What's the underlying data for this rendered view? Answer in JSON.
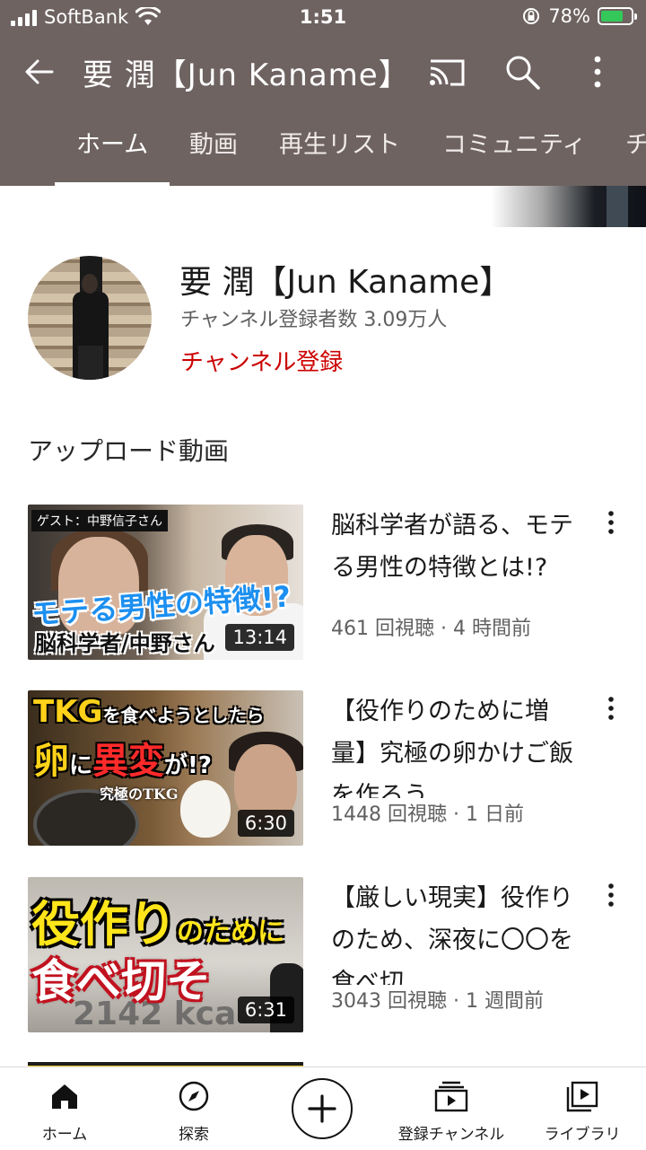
{
  "status_bar": {
    "carrier": "SoftBank",
    "time": "1:51",
    "battery_percent": "78%",
    "battery_level": 0.78
  },
  "app_bar": {
    "title": "要 潤【Jun Kaname】",
    "icons": [
      "arrow-left-icon",
      "cast-icon",
      "search-icon",
      "more-vertical-icon"
    ]
  },
  "tabs": [
    {
      "label": "ホーム",
      "active": true
    },
    {
      "label": "動画",
      "active": false
    },
    {
      "label": "再生リスト",
      "active": false
    },
    {
      "label": "コミュニティ",
      "active": false
    },
    {
      "label": "チ",
      "active": false
    }
  ],
  "channel": {
    "name": "要 潤【Jun Kaname】",
    "subscribers": "チャンネル登録者数 3.09万人",
    "subscribe_label": "チャンネル登録"
  },
  "section": {
    "title": "アップロード動画"
  },
  "videos": [
    {
      "title": "脳科学者が語る、モテる男性の特徴とは!?",
      "meta": "461 回視聴 · 4 時間前",
      "duration": "13:14",
      "thumb_text": [
        "ゲスト：中野信子さん",
        "モテる男性の特徴!?",
        "脳科学者/中野さん"
      ]
    },
    {
      "title": "【役作りのために増量】究極の卵かけご飯を作ろう…",
      "meta": "1448 回視聴 · 1 日前",
      "duration": "6:30",
      "thumb_text": [
        "TKG",
        "を食べようとしたら",
        "卵",
        "に",
        "異変",
        "が!?",
        "究極のTKG"
      ]
    },
    {
      "title": "【厳しい現実】役作りのため、深夜に〇〇を食べ切…",
      "meta": "3043 回視聴 · 1 週間前",
      "duration": "6:31",
      "thumb_text": [
        "役作り",
        "のために",
        "食べ切そ",
        "2142 kca"
      ]
    }
  ],
  "bottom_nav": [
    {
      "label": "ホーム",
      "icon": "home-icon",
      "active": true
    },
    {
      "label": "探索",
      "icon": "compass-icon",
      "active": false
    },
    {
      "label": "",
      "icon": "plus-icon",
      "active": false
    },
    {
      "label": "登録チャンネル",
      "icon": "subscriptions-icon",
      "active": false
    },
    {
      "label": "ライブラリ",
      "icon": "library-icon",
      "active": false
    }
  ],
  "colors": {
    "header_bg": "#6e6361",
    "subscribe_red": "#cc0000",
    "meta_gray": "#606060"
  }
}
